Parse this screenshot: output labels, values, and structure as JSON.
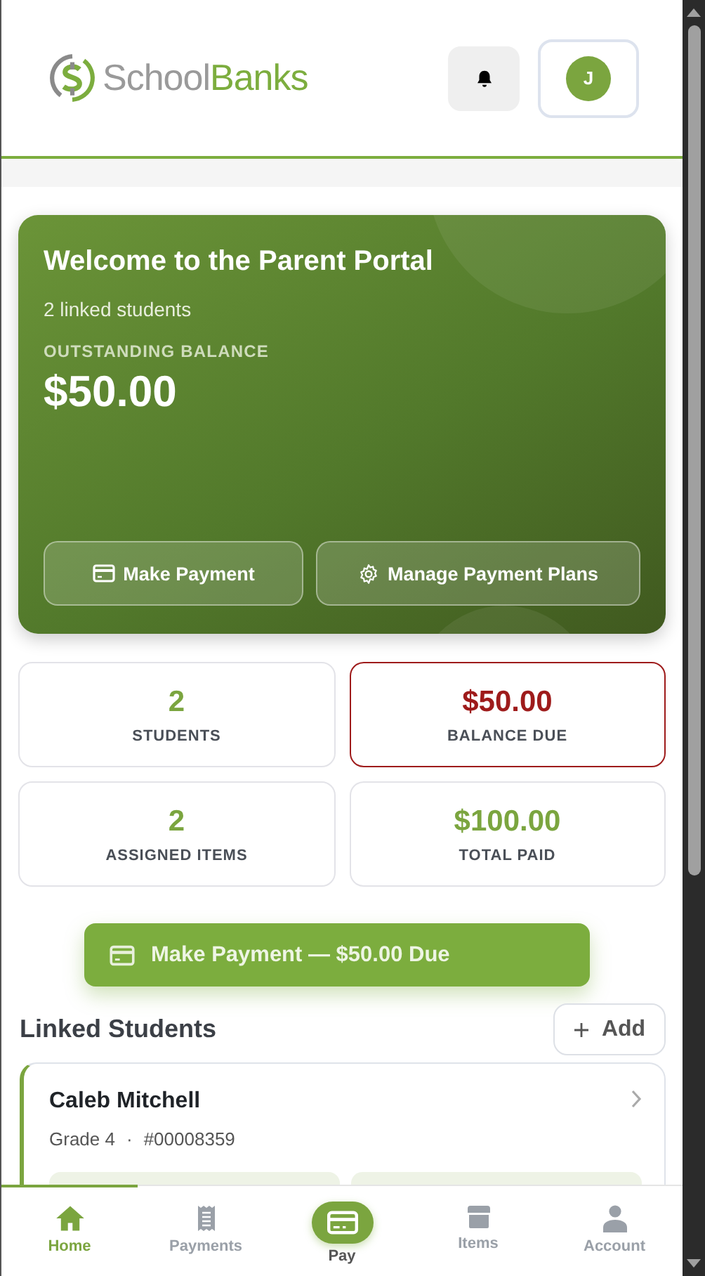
{
  "header": {
    "logo": {
      "plain": "School",
      "bold": "Banks"
    },
    "avatar": "J"
  },
  "hero": {
    "title": "Welcome to the Parent Portal",
    "subtitle": "2 linked students",
    "balance_label": "OUTSTANDING BALANCE",
    "balance": "$50.00",
    "buttons": [
      {
        "kind": "card",
        "label": "Make Payment"
      },
      {
        "kind": "gear",
        "label": "Manage Payment Plans"
      }
    ]
  },
  "stats": [
    {
      "value": "2",
      "label": "STUDENTS",
      "alert": false
    },
    {
      "value": "$50.00",
      "label": "BALANCE DUE",
      "alert": true
    },
    {
      "value": "2",
      "label": "ASSIGNED ITEMS",
      "alert": false
    },
    {
      "value": "$100.00",
      "label": "TOTAL PAID",
      "alert": false
    }
  ],
  "pay_button": "Make Payment — $50.00 Due",
  "linked_students": {
    "title": "Linked Students",
    "add_button": "Add",
    "students": [
      {
        "name": "Caleb Mitchell",
        "grade": "Grade 4",
        "separator": "·",
        "id": "#00008359"
      }
    ]
  },
  "nav": [
    {
      "kind": "home",
      "label": "Home",
      "selected": true
    },
    {
      "kind": "payments",
      "label": "Payments",
      "selected": false
    },
    {
      "kind": "pay",
      "label": "Pay",
      "selected": false
    },
    {
      "kind": "items",
      "label": "Items",
      "selected": false
    },
    {
      "kind": "account",
      "label": "Account",
      "selected": false
    }
  ]
}
